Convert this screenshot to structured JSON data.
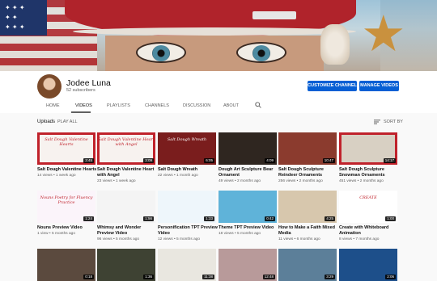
{
  "channel": {
    "name": "Jodee Luna",
    "subscribers": "52 subscribers",
    "customize_label": "CUSTOMIZE CHANNEL",
    "manage_label": "MANAGE VIDEOS"
  },
  "tabs": [
    {
      "label": "HOME"
    },
    {
      "label": "VIDEOS"
    },
    {
      "label": "PLAYLISTS"
    },
    {
      "label": "CHANNELS"
    },
    {
      "label": "DISCUSSION"
    },
    {
      "label": "ABOUT"
    }
  ],
  "uploads": {
    "title": "Uploads",
    "play_all": "PLAY ALL",
    "sort_by": "SORT BY"
  },
  "colors": {
    "accent": "#065fd4",
    "banner_red": "#b0232b"
  },
  "videos_row1": [
    {
      "title": "Salt Dough Valentine Hearts",
      "meta": "14 views • 1 week ago",
      "duration": "3:45",
      "caption": "Salt Dough Valentine Hearts",
      "thumb_color": "#f7f2ef",
      "border": "#c0222b"
    },
    {
      "title": "Salt Dough Valentine Heart with Angel",
      "meta": "23 views • 1 week ago",
      "duration": "3:09",
      "caption": "Salt Dough Valentine Heart with Angel",
      "thumb_color": "#f7f2ef",
      "border": "#c0222b"
    },
    {
      "title": "Salt Dough Wreath",
      "meta": "22 views • 1 month ago",
      "duration": "6:05",
      "caption": "Salt Dough Wreath",
      "thumb_color": "#7a1d1d",
      "border": ""
    },
    {
      "title": "Dough Art Sculpture Bear Ornament",
      "meta": "49 views • 2 months ago",
      "duration": "4:09",
      "caption": "",
      "thumb_color": "#2f2620",
      "border": ""
    },
    {
      "title": "Salt Dough Sculpture Reindeer Ornaments",
      "meta": "256 views • 2 months ago",
      "duration": "10:47",
      "caption": "",
      "thumb_color": "#8b3b2e",
      "border": ""
    },
    {
      "title": "Salt Dough Sculpture Snowman Ornaments",
      "meta": "451 views • 2 months ago",
      "duration": "14:17",
      "caption": "",
      "thumb_color": "#d8d0c3",
      "border": "#c0222b"
    }
  ],
  "videos_row2": [
    {
      "title": "Nouns Preview Video",
      "meta": "1 view • 5 months ago",
      "duration": "1:24",
      "caption": "Nouns Poetry for Fluency Practice",
      "thumb_color": "#fbf4fa"
    },
    {
      "title": "Whimsy and Wonder Preview Video",
      "meta": "96 views • 5 months ago",
      "duration": "1:56",
      "caption": "",
      "thumb_color": "#f4f4f4"
    },
    {
      "title": "Personification TPT Preview Video",
      "meta": "12 views • 5 months ago",
      "duration": "1:33",
      "caption": "",
      "thumb_color": "#eef6fb"
    },
    {
      "title": "Theme TPT Preview Video",
      "meta": "18 views • 5 months ago",
      "duration": "0:42",
      "caption": "",
      "thumb_color": "#5fb3d9"
    },
    {
      "title": "How to Make a Faith Mixed Media",
      "meta": "11 views • 6 months ago",
      "duration": "4:25",
      "caption": "",
      "thumb_color": "#d7c7ad"
    },
    {
      "title": "Create with Whiteboard Animation",
      "meta": "8 views • 7 months ago",
      "duration": "1:00",
      "caption": "CREATE",
      "thumb_color": "#ffffff"
    }
  ],
  "videos_row3": [
    {
      "duration": "0:18",
      "thumb_color": "#5b4a3e"
    },
    {
      "duration": "1:36",
      "thumb_color": "#3e4233"
    },
    {
      "duration": "11:38",
      "thumb_color": "#e9e7e0"
    },
    {
      "duration": "12:48",
      "thumb_color": "#b89a9a"
    },
    {
      "duration": "3:29",
      "thumb_color": "#5c7f99"
    },
    {
      "duration": "2:06",
      "thumb_color": "#1d4f8a"
    }
  ]
}
